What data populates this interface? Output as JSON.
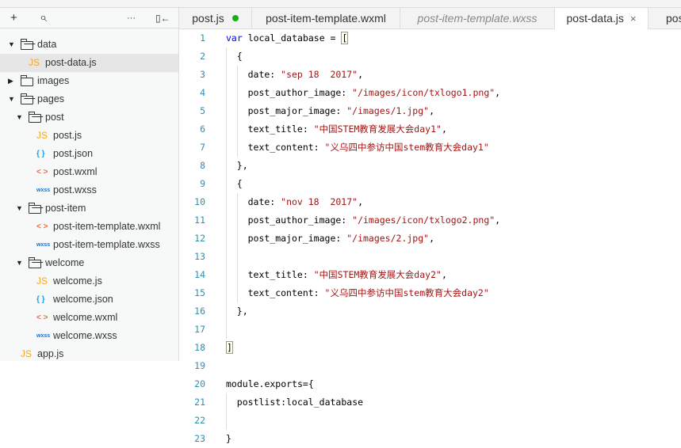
{
  "toolbar": {
    "add": "+",
    "search": "⌕",
    "more": "···",
    "collapse": "▯←"
  },
  "tree": [
    {
      "type": "folder",
      "open": true,
      "depth": 0,
      "label": "data"
    },
    {
      "type": "js",
      "depth": 1,
      "label": "post-data.js",
      "selected": true
    },
    {
      "type": "folder",
      "open": false,
      "depth": 0,
      "label": "images"
    },
    {
      "type": "folder",
      "open": true,
      "depth": 0,
      "label": "pages"
    },
    {
      "type": "folder",
      "open": true,
      "depth": 1,
      "label": "post"
    },
    {
      "type": "js",
      "depth": 2,
      "label": "post.js"
    },
    {
      "type": "json",
      "depth": 2,
      "label": "post.json"
    },
    {
      "type": "wxml",
      "depth": 2,
      "label": "post.wxml"
    },
    {
      "type": "wxss",
      "depth": 2,
      "label": "post.wxss"
    },
    {
      "type": "folder",
      "open": true,
      "depth": 1,
      "label": "post-item"
    },
    {
      "type": "wxml",
      "depth": 2,
      "label": "post-item-template.wxml"
    },
    {
      "type": "wxss",
      "depth": 2,
      "label": "post-item-template.wxss"
    },
    {
      "type": "folder",
      "open": true,
      "depth": 1,
      "label": "welcome"
    },
    {
      "type": "js",
      "depth": 2,
      "label": "welcome.js"
    },
    {
      "type": "json",
      "depth": 2,
      "label": "welcome.json"
    },
    {
      "type": "wxml",
      "depth": 2,
      "label": "welcome.wxml"
    },
    {
      "type": "wxss",
      "depth": 2,
      "label": "welcome.wxss"
    },
    {
      "type": "js",
      "depth": 0,
      "label": "app.js"
    }
  ],
  "icons": {
    "js": {
      "glyph": "JS",
      "color": "#f5a623"
    },
    "json": {
      "glyph": "{ }",
      "color": "#1e9fe6"
    },
    "wxml": {
      "glyph": "< >",
      "color": "#f26b3a"
    },
    "wxss": {
      "glyph": "wxss",
      "color": "#1c6fc6"
    }
  },
  "tabs": [
    {
      "label": "post.js",
      "modified": true
    },
    {
      "label": "post-item-template.wxml"
    },
    {
      "label": "post-item-template.wxss",
      "italic": true
    },
    {
      "label": "post-data.js",
      "active": true,
      "close": "×"
    },
    {
      "label": "post-item-template.wxml"
    }
  ],
  "code": [
    {
      "n": "1",
      "ind": 0,
      "seg": [
        [
          "k",
          "var"
        ],
        [
          "p",
          " local_database = "
        ],
        [
          "c",
          "["
        ]
      ]
    },
    {
      "n": "2",
      "ind": 1,
      "seg": [
        [
          "p",
          "{"
        ]
      ]
    },
    {
      "n": "3",
      "ind": 2,
      "seg": [
        [
          "p",
          "date: "
        ],
        [
          "s",
          "\"sep 18  2017\""
        ],
        [
          "p",
          ","
        ]
      ]
    },
    {
      "n": "4",
      "ind": 2,
      "seg": [
        [
          "p",
          "post_author_image: "
        ],
        [
          "s",
          "\"/images/icon/txlogo1.png\""
        ],
        [
          "p",
          ","
        ]
      ]
    },
    {
      "n": "5",
      "ind": 2,
      "seg": [
        [
          "p",
          "post_major_image: "
        ],
        [
          "s",
          "\"/images/1.jpg\""
        ],
        [
          "p",
          ","
        ]
      ]
    },
    {
      "n": "6",
      "ind": 2,
      "seg": [
        [
          "p",
          "text_title: "
        ],
        [
          "s",
          "\"中国STEM教育发展大会day1\""
        ],
        [
          "p",
          ","
        ]
      ]
    },
    {
      "n": "7",
      "ind": 2,
      "seg": [
        [
          "p",
          "text_content: "
        ],
        [
          "s",
          "\"义乌四中参访中国stem教育大会day1\""
        ]
      ]
    },
    {
      "n": "8",
      "ind": 1,
      "seg": [
        [
          "p",
          "},"
        ]
      ]
    },
    {
      "n": "9",
      "ind": 1,
      "seg": [
        [
          "p",
          "{"
        ]
      ]
    },
    {
      "n": "10",
      "ind": 2,
      "seg": [
        [
          "p",
          "date: "
        ],
        [
          "s",
          "\"nov 18  2017\""
        ],
        [
          "p",
          ","
        ]
      ]
    },
    {
      "n": "11",
      "ind": 2,
      "seg": [
        [
          "p",
          "post_author_image: "
        ],
        [
          "s",
          "\"/images/icon/txlogo2.png\""
        ],
        [
          "p",
          ","
        ]
      ]
    },
    {
      "n": "12",
      "ind": 2,
      "seg": [
        [
          "p",
          "post_major_image: "
        ],
        [
          "s",
          "\"/images/2.jpg\""
        ],
        [
          "p",
          ","
        ]
      ]
    },
    {
      "n": "13",
      "ind": 2,
      "seg": []
    },
    {
      "n": "14",
      "ind": 2,
      "seg": [
        [
          "p",
          "text_title: "
        ],
        [
          "s",
          "\"中国STEM教育发展大会day2\""
        ],
        [
          "p",
          ","
        ]
      ]
    },
    {
      "n": "15",
      "ind": 2,
      "seg": [
        [
          "p",
          "text_content: "
        ],
        [
          "s",
          "\"义乌四中参访中国stem教育大会day2\""
        ]
      ]
    },
    {
      "n": "16",
      "ind": 1,
      "seg": [
        [
          "p",
          "},"
        ]
      ]
    },
    {
      "n": "17",
      "ind": 1,
      "seg": []
    },
    {
      "n": "18",
      "ind": 0,
      "seg": [
        [
          "c",
          "]"
        ]
      ]
    },
    {
      "n": "19",
      "ind": 0,
      "seg": []
    },
    {
      "n": "20",
      "ind": 0,
      "seg": [
        [
          "p",
          "module.exports={"
        ]
      ]
    },
    {
      "n": "21",
      "ind": 1,
      "seg": [
        [
          "p",
          "postlist:local_database"
        ]
      ]
    },
    {
      "n": "22",
      "ind": 1,
      "seg": []
    },
    {
      "n": "23",
      "ind": 0,
      "seg": [
        [
          "p",
          "}"
        ]
      ]
    }
  ]
}
